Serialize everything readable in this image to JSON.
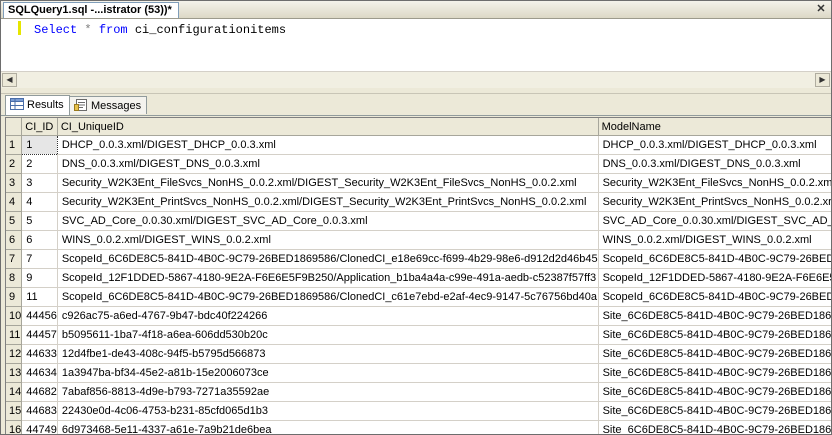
{
  "tab": {
    "title": "SQLQuery1.sql -...istrator (53))*",
    "close_glyph": "✕"
  },
  "editor": {
    "kw1": "Select",
    "star": "*",
    "kw2": "from",
    "table": "ci_configurationitems"
  },
  "scroll": {
    "left": "◀",
    "right": "▶"
  },
  "results_tabs": [
    {
      "label": "Results",
      "icon": "grid-icon",
      "active": true
    },
    {
      "label": "Messages",
      "icon": "messages-icon",
      "active": false
    }
  ],
  "grid": {
    "columns": [
      "CI_ID",
      "CI_UniqueID",
      "ModelName"
    ],
    "rows": [
      [
        "1",
        "1",
        "DHCP_0.0.3.xml/DIGEST_DHCP_0.0.3.xml",
        "DHCP_0.0.3.xml/DIGEST_DHCP_0.0.3.xml"
      ],
      [
        "2",
        "2",
        "DNS_0.0.3.xml/DIGEST_DNS_0.0.3.xml",
        "DNS_0.0.3.xml/DIGEST_DNS_0.0.3.xml"
      ],
      [
        "3",
        "3",
        "Security_W2K3Ent_FileSvcs_NonHS_0.0.2.xml/DIGEST_Security_W2K3Ent_FileSvcs_NonHS_0.0.2.xml",
        "Security_W2K3Ent_FileSvcs_NonHS_0.0.2.xml/"
      ],
      [
        "4",
        "4",
        "Security_W2K3Ent_PrintSvcs_NonHS_0.0.2.xml/DIGEST_Security_W2K3Ent_PrintSvcs_NonHS_0.0.2.xml",
        "Security_W2K3Ent_PrintSvcs_NonHS_0.0.2.xr"
      ],
      [
        "5",
        "5",
        "SVC_AD_Core_0.0.30.xml/DIGEST_SVC_AD_Core_0.0.3.xml",
        "SVC_AD_Core_0.0.30.xml/DIGEST_SVC_AD_Core"
      ],
      [
        "6",
        "6",
        "WINS_0.0.2.xml/DIGEST_WINS_0.0.2.xml",
        "WINS_0.0.2.xml/DIGEST_WINS_0.0.2.xml"
      ],
      [
        "7",
        "7",
        "ScopeId_6C6DE8C5-841D-4B0C-9C79-26BED1869586/ClonedCI_e18e69cc-f699-4b29-98e6-d912d2d46b45",
        "ScopeId_6C6DE8C5-841D-4B0C-9C79-26BED18"
      ],
      [
        "8",
        "9",
        "ScopeId_12F1DDED-5867-4180-9E2A-F6E6E5F9B250/Application_b1ba4a4a-c99e-491a-aedb-c52387f57ff3",
        "ScopeId_12F1DDED-5867-4180-9E2A-F6E6E5F"
      ],
      [
        "9",
        "11",
        "ScopeId_6C6DE8C5-841D-4B0C-9C79-26BED1869586/ClonedCI_c61e7ebd-e2af-4ec9-9147-5c76756bd40a",
        "ScopeId_6C6DE8C5-841D-4B0C-9C79-26BED18"
      ],
      [
        "10",
        "44456",
        "c926ac75-a6ed-4767-9b47-bdc40f224266",
        "Site_6C6DE8C5-841D-4B0C-9C79-26BED1869"
      ],
      [
        "11",
        "44457",
        "b5095611-1ba7-4f18-a6ea-606dd530b20c",
        "Site_6C6DE8C5-841D-4B0C-9C79-26BED1869"
      ],
      [
        "12",
        "44633",
        "12d4fbe1-de43-408c-94f5-b5795d566873",
        "Site_6C6DE8C5-841D-4B0C-9C79-26BED1869"
      ],
      [
        "13",
        "44634",
        "1a3947ba-bf34-45e2-a81b-15e2006073ce",
        "Site_6C6DE8C5-841D-4B0C-9C79-26BED1869"
      ],
      [
        "14",
        "44682",
        "7abaf856-8813-4d9e-b793-7271a35592ae",
        "Site_6C6DE8C5-841D-4B0C-9C79-26BED1869"
      ],
      [
        "15",
        "44683",
        "22430e0d-4c06-4753-b231-85cfd065d1b3",
        "Site_6C6DE8C5-841D-4B0C-9C79-26BED1869"
      ],
      [
        "16",
        "44749",
        "6d973468-5e11-4337-a61e-7a9b21de6bea",
        "Site_6C6DE8C5-841D-4B0C-9C79-26BED1869"
      ]
    ]
  }
}
